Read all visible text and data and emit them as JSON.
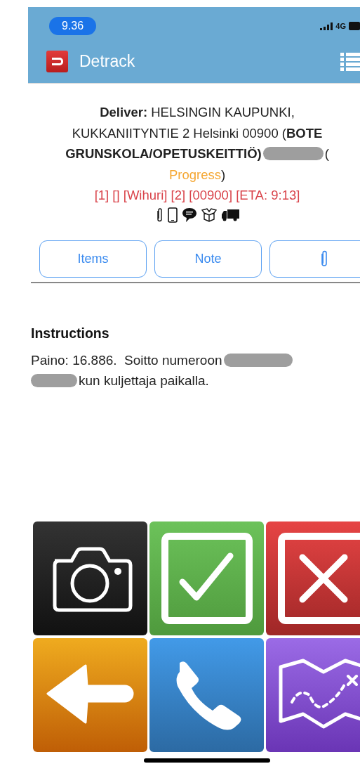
{
  "status_bar": {
    "time": "9.36",
    "network": "4G"
  },
  "header": {
    "title": "Detrack"
  },
  "delivery": {
    "lines": [
      "**Deliver:** HELSINGIN KAUPUNKI,",
      "KUKKANIITYNTIE 2 Helsinki 00900 (**BOTE**"
    ],
    "line3": {
      "text": "GRUNSKOLA/OPETUSKEITTIÖ)",
      "after": "("
    },
    "status": {
      "text": "Progress",
      "close": ")"
    },
    "tags": "[1] [] [Wihuri] [2] [00900] [ETA: 9:13]",
    "icons": [
      {
        "kind": "attachment"
      },
      {
        "kind": "phone"
      },
      {
        "kind": "message"
      },
      {
        "kind": "package"
      },
      {
        "kind": "truck"
      }
    ]
  },
  "buttons": [
    {
      "kind": "text",
      "label": "Items"
    },
    {
      "kind": "text",
      "label": "Note"
    },
    {
      "kind": "attachment"
    }
  ],
  "instructions": {
    "title": "Instructions",
    "line1": "Paino: 16.886.  Soitto numeroon",
    "line2": "kun kuljettaja paikalla."
  },
  "action_tiles": [
    {
      "kind": "camera"
    },
    {
      "kind": "complete"
    },
    {
      "kind": "fail"
    },
    {
      "kind": "back"
    },
    {
      "kind": "call"
    },
    {
      "kind": "map"
    }
  ]
}
